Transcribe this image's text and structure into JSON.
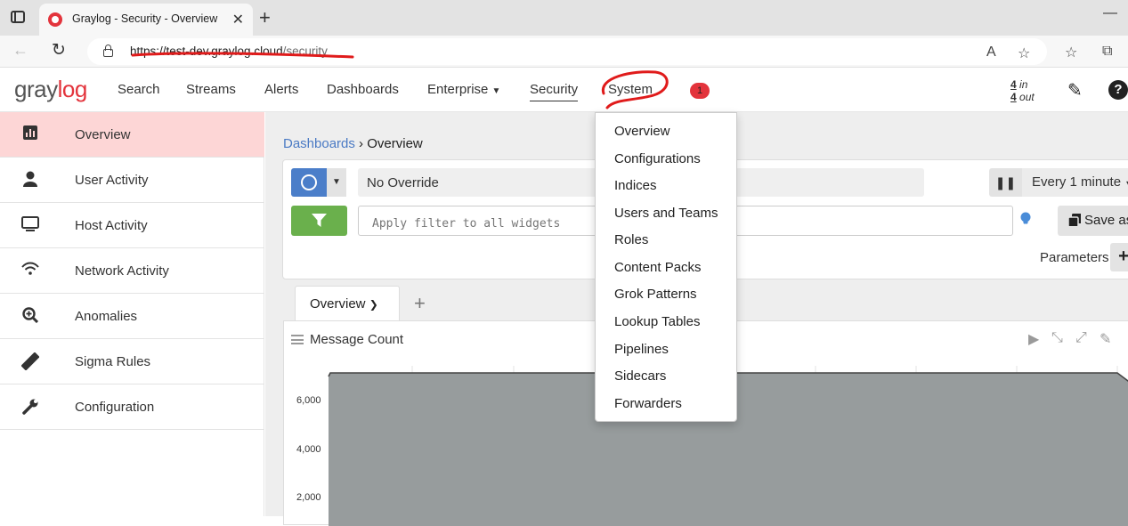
{
  "browser": {
    "tab_title": "Graylog - Security - Overview",
    "url_host": "https://test-dev.graylog.cloud",
    "url_path": "/security"
  },
  "header": {
    "logo": {
      "gray": "gray",
      "red_lo": "lo",
      "g": "g"
    },
    "nav": [
      "Search",
      "Streams",
      "Alerts",
      "Dashboards",
      "Enterprise",
      "Security",
      "System"
    ],
    "notification_count": "1",
    "throughput_in_num": "4",
    "throughput_in_label": " in",
    "throughput_out_num": "4",
    "throughput_out_label": " out"
  },
  "sidebar": {
    "items": [
      {
        "label": "Overview",
        "icon": "bar-chart-icon"
      },
      {
        "label": "User Activity",
        "icon": "user-icon"
      },
      {
        "label": "Host Activity",
        "icon": "monitor-icon"
      },
      {
        "label": "Network Activity",
        "icon": "wifi-icon"
      },
      {
        "label": "Anomalies",
        "icon": "search-plus-icon"
      },
      {
        "label": "Sigma Rules",
        "icon": "ruler-icon"
      },
      {
        "label": "Configuration",
        "icon": "wrench-icon"
      }
    ]
  },
  "main": {
    "breadcrumb_link": "Dashboards",
    "breadcrumb_sep": " › ",
    "breadcrumb_current": "Overview",
    "time_override": "No Override",
    "refresh_interval": "Every 1 minute",
    "filter_placeholder": "Apply filter to all widgets",
    "save_as": "Save as",
    "parameters_label": "Parameters",
    "tab_label": "Overview"
  },
  "widget": {
    "title": "Message Count"
  },
  "chart_data": {
    "type": "area",
    "title": "Message Count",
    "yticks": [
      "6,000",
      "4,000",
      "2,000"
    ],
    "color": "#979c9d"
  },
  "system_menu": {
    "items": [
      "Overview",
      "Configurations",
      "Indices",
      "Users and Teams",
      "Roles",
      "Content Packs",
      "Grok Patterns",
      "Lookup Tables",
      "Pipelines",
      "Sidecars",
      "Forwarders"
    ]
  },
  "colors": {
    "accent": "#e3343c",
    "sidebar_active": "#fdd6d6",
    "primary_button": "#4b7ec9",
    "filter_button": "#6ab04c",
    "link": "#4a7ac4"
  }
}
